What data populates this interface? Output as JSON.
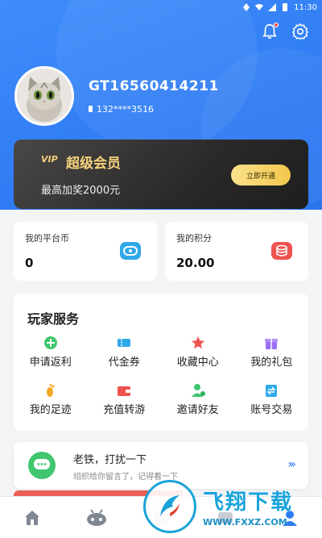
{
  "statusbar": {
    "time": "11:30"
  },
  "profile": {
    "username": "GT16560414211",
    "phone": "132****3516"
  },
  "vip": {
    "tag": "VIP",
    "title": "超级会员",
    "subtitle": "最高加奖2000元",
    "button": "立即开通"
  },
  "stats": [
    {
      "label": "我的平台币",
      "value": "0",
      "icon": "coin-icon",
      "color": "#2fa8e8"
    },
    {
      "label": "我的积分",
      "value": "20.00",
      "icon": "points-icon",
      "color": "#ef5350"
    }
  ],
  "services": {
    "title": "玩家服务",
    "items": [
      {
        "label": "申请返利",
        "icon": "rebate-icon",
        "color": "#3fc66e"
      },
      {
        "label": "代金券",
        "icon": "voucher-icon",
        "color": "#2fa8e8"
      },
      {
        "label": "收藏中心",
        "icon": "star-icon",
        "color": "#ef5350"
      },
      {
        "label": "我的礼包",
        "icon": "gift-icon",
        "color": "#9b6ff2"
      },
      {
        "label": "我的足迹",
        "icon": "footprint-icon",
        "color": "#f6a623"
      },
      {
        "label": "充值转游",
        "icon": "wallet-icon",
        "color": "#ef5350"
      },
      {
        "label": "邀请好友",
        "icon": "invite-icon",
        "color": "#3fc66e"
      },
      {
        "label": "账号交易",
        "icon": "trade-icon",
        "color": "#2fa8e8"
      }
    ]
  },
  "message": {
    "title": "老铁，打扰一下",
    "subtitle": "组织给你留言了，记得看一下"
  },
  "watermark": {
    "title": "飞翔下载",
    "url": "WWW.FXXZ.COM"
  },
  "colors": {
    "brand": "#2f7cf4",
    "vip_gold": "#f6d27d"
  }
}
